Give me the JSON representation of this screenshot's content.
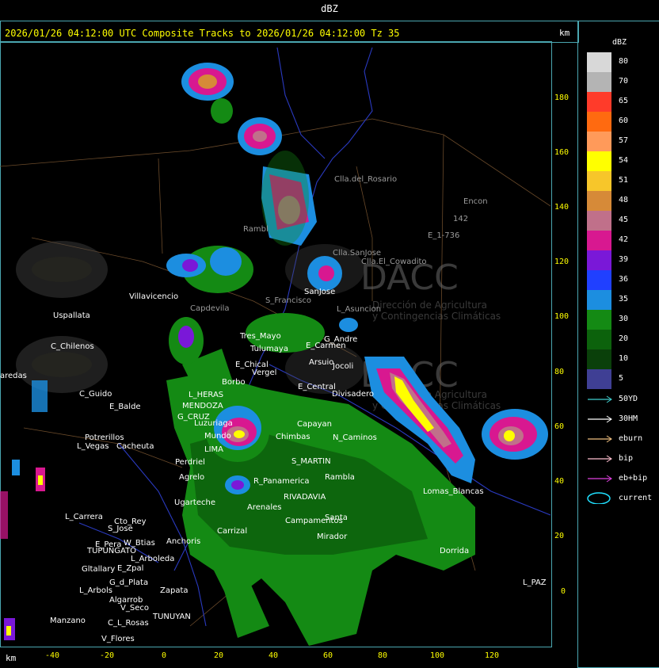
{
  "title": "dBZ",
  "header": "2026/01/26 04:12:00 UTC Composite Tracks to 2026/01/26 04:12:00 Tz 35",
  "axis_unit": "km",
  "legend": {
    "title": "dBZ",
    "items": [
      {
        "label": "80",
        "color": "#d8d8d8"
      },
      {
        "label": "70",
        "color": "#b4b4b4"
      },
      {
        "label": "65",
        "color": "#ff3b2a"
      },
      {
        "label": "60",
        "color": "#ff6a10"
      },
      {
        "label": "57",
        "color": "#ff9a5a"
      },
      {
        "label": "54",
        "color": "#ffff00"
      },
      {
        "label": "51",
        "color": "#f7c62a"
      },
      {
        "label": "48",
        "color": "#d68a38"
      },
      {
        "label": "45",
        "color": "#c0708a"
      },
      {
        "label": "42",
        "color": "#d81890"
      },
      {
        "label": "39",
        "color": "#7a18d8"
      },
      {
        "label": "36",
        "color": "#2040ff"
      },
      {
        "label": "35",
        "color": "#1c8ee0"
      },
      {
        "label": "30",
        "color": "#148a14"
      },
      {
        "label": "20",
        "color": "#0c620c"
      },
      {
        "label": "10",
        "color": "#0a400a"
      },
      {
        "label": "5",
        "color": "#3f3f94"
      }
    ]
  },
  "tracks": [
    {
      "label": "50YD",
      "color": "#40d0d0"
    },
    {
      "label": "30HM",
      "color": "#ffffff"
    },
    {
      "label": "eburn",
      "color": "#f0c080"
    },
    {
      "label": "bip",
      "color": "#ffc0d0"
    },
    {
      "label": "eb+bip",
      "color": "#e040e0"
    },
    {
      "label": "current",
      "color": "#20e0ff"
    }
  ],
  "y_ticks": [
    "180",
    "160",
    "140",
    "120",
    "100",
    "80",
    "60",
    "40",
    "20",
    "0"
  ],
  "x_ticks": [
    "-40",
    "-20",
    "0",
    "20",
    "40",
    "60",
    "80",
    "100",
    "120"
  ],
  "watermark": {
    "name": "DACC",
    "line1": "Dirección de Agricultura",
    "line2": "y Contingencias Climáticas"
  },
  "places": [
    {
      "name": "Clla.del_Rosario"
    },
    {
      "name": "Encon"
    },
    {
      "name": "142"
    },
    {
      "name": "E_1-736"
    },
    {
      "name": "Rambl"
    },
    {
      "name": "Clla.SanJose"
    },
    {
      "name": "Clla.El_Cowadito"
    },
    {
      "name": "SanJose"
    },
    {
      "name": "Villavicencio"
    },
    {
      "name": "Uspallata"
    },
    {
      "name": "Capdevila"
    },
    {
      "name": "S_Francisco"
    },
    {
      "name": "L_Asuncion"
    },
    {
      "name": "C_Chilenos"
    },
    {
      "name": "Tres_Mayo"
    },
    {
      "name": "Tulumaya"
    },
    {
      "name": "E_Carmen"
    },
    {
      "name": "G_Andre"
    },
    {
      "name": "E_Chical"
    },
    {
      "name": "Vergel"
    },
    {
      "name": "Arsuio"
    },
    {
      "name": "Jocoli"
    },
    {
      "name": "aredas"
    },
    {
      "name": "Borbo"
    },
    {
      "name": "E_Central"
    },
    {
      "name": "Divisadero"
    },
    {
      "name": "C_Guido"
    },
    {
      "name": "L_HERAS"
    },
    {
      "name": "E_Balde"
    },
    {
      "name": "MENDOZA"
    },
    {
      "name": "G_CRUZ"
    },
    {
      "name": "Luzuriaga"
    },
    {
      "name": "Mundo"
    },
    {
      "name": "Potrerillos"
    },
    {
      "name": "L_Vegas"
    },
    {
      "name": "Cacheuta"
    },
    {
      "name": "LIMA"
    },
    {
      "name": "Perdriel"
    },
    {
      "name": "Chimbas"
    },
    {
      "name": "Capayan"
    },
    {
      "name": "N_Caminos"
    },
    {
      "name": "S_MARTIN"
    },
    {
      "name": "Rambla"
    },
    {
      "name": "Agrelo"
    },
    {
      "name": "R_Panamerica"
    },
    {
      "name": "RIVADAVIA"
    },
    {
      "name": "Lomas_Blancas"
    },
    {
      "name": "Ugarteche"
    },
    {
      "name": "Arenales"
    },
    {
      "name": "Campamentos"
    },
    {
      "name": "Santa"
    },
    {
      "name": "L_Carrera"
    },
    {
      "name": "Cto_Rey"
    },
    {
      "name": "S_Jose"
    },
    {
      "name": "Carrizal"
    },
    {
      "name": "Mirador"
    },
    {
      "name": "Anchoris"
    },
    {
      "name": "W_Btias"
    },
    {
      "name": "E_Pera"
    },
    {
      "name": "TUPUNGATO"
    },
    {
      "name": "L_Arboleda"
    },
    {
      "name": "Dorrida"
    },
    {
      "name": "Gltallary"
    },
    {
      "name": "E_Zpal"
    },
    {
      "name": "G_d_Plata"
    },
    {
      "name": "L_Arbols"
    },
    {
      "name": "Zapata"
    },
    {
      "name": "L_PAZ"
    },
    {
      "name": "Algarrob"
    },
    {
      "name": "V_Seco"
    },
    {
      "name": "Manzano"
    },
    {
      "name": "C_L_Rosas"
    },
    {
      "name": "TUNUYAN"
    },
    {
      "name": "V_Flores"
    }
  ]
}
